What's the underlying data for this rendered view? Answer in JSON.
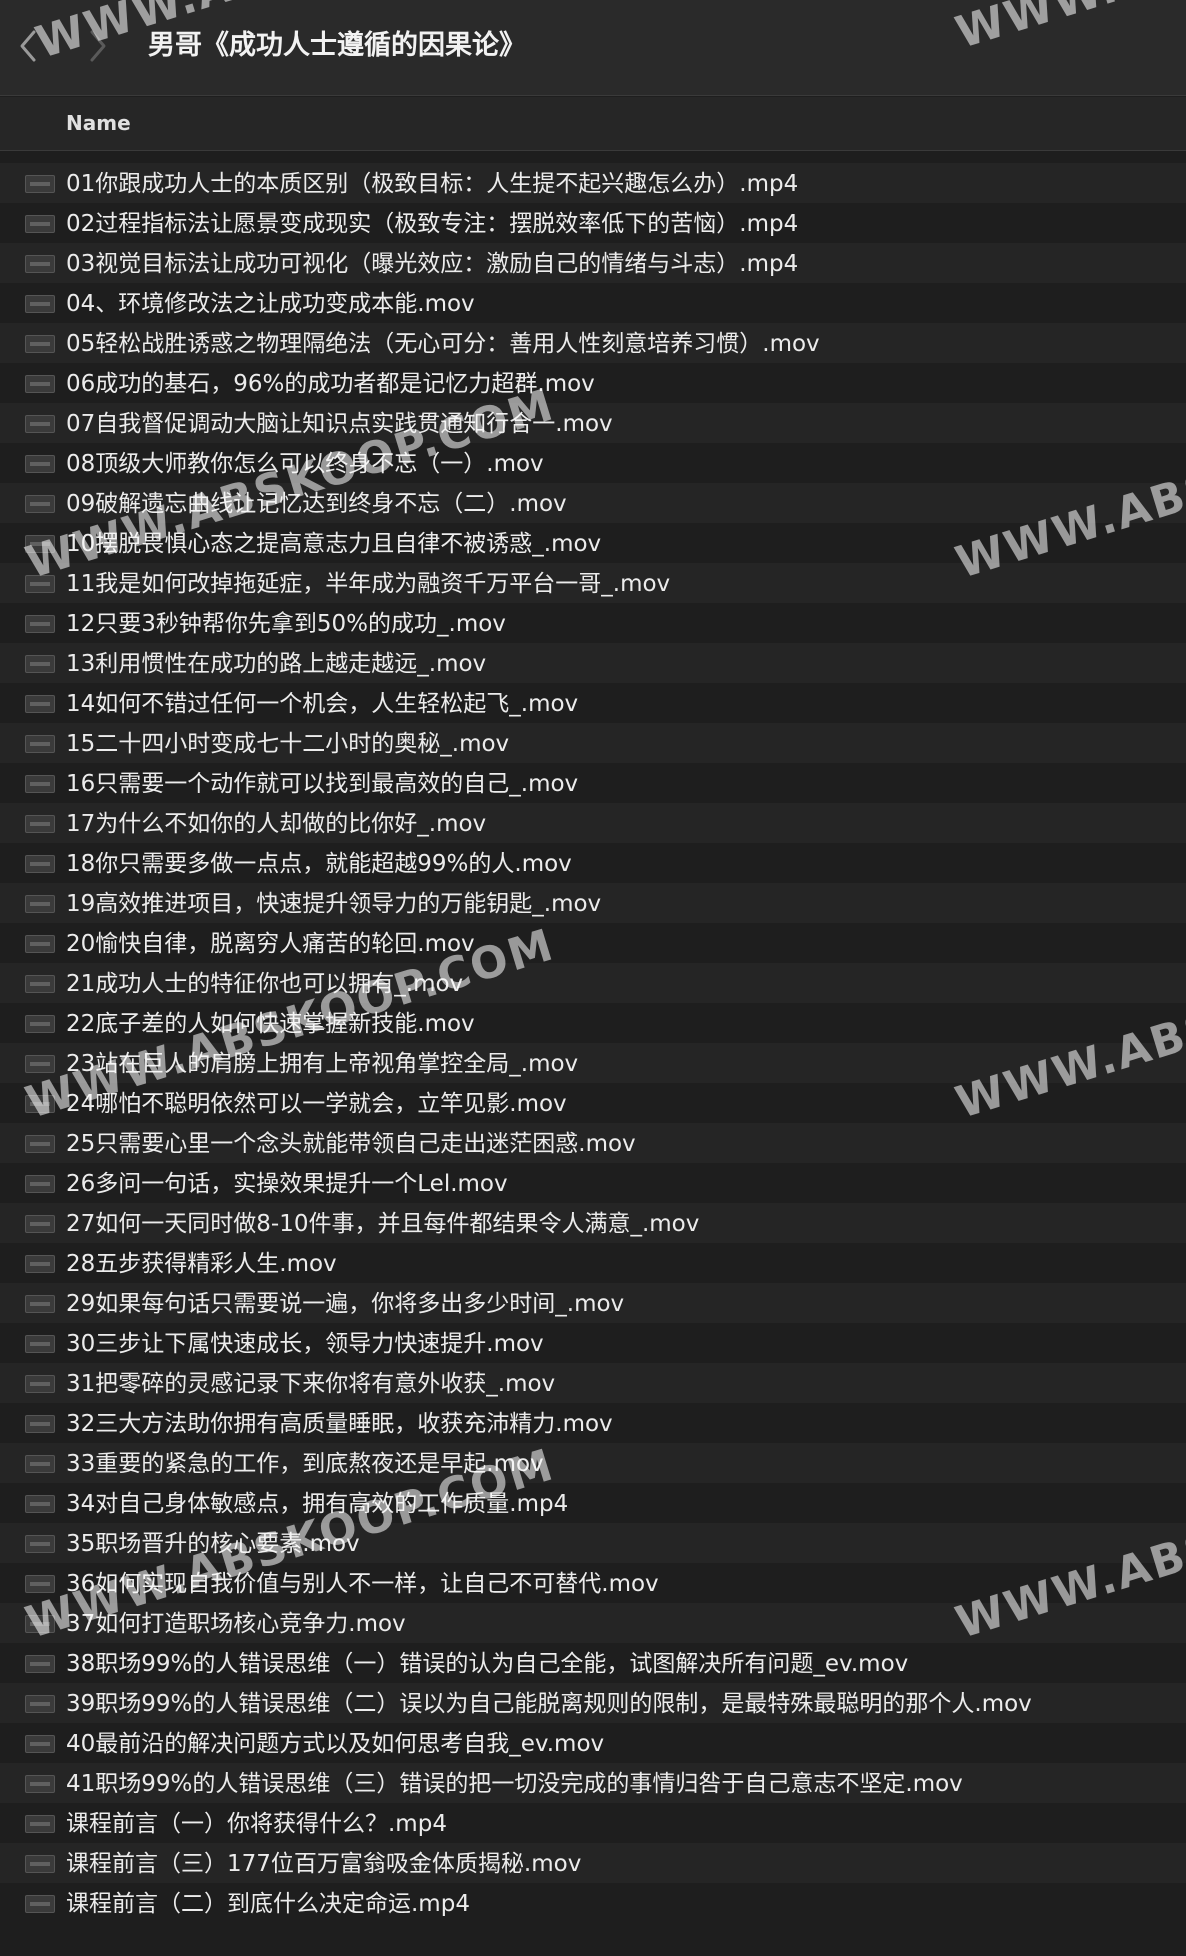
{
  "window": {
    "title": "男哥《成功人士遵循的因果论》",
    "back_icon": "chevron-left-icon",
    "forward_icon": "chevron-right-icon"
  },
  "header": {
    "name_column": "Name"
  },
  "files": [
    "01你跟成功人士的本质区别（极致目标：人生提不起兴趣怎么办）.mp4",
    "02过程指标法让愿景变成现实（极致专注：摆脱效率低下的苦恼）.mp4",
    "03视觉目标法让成功可视化（曝光效应：激励自己的情绪与斗志）.mp4",
    "04、环境修改法之让成功变成本能.mov",
    "05轻松战胜诱惑之物理隔绝法（无心可分：善用人性刻意培养习惯）.mov",
    "06成功的基石，96%的成功者都是记忆力超群.mov",
    "07自我督促调动大脑让知识点实践贯通知行合一.mov",
    "08顶级大师教你怎么可以终身不忘（一）.mov",
    "09破解遗忘曲线让记忆达到终身不忘（二）.mov",
    "10摆脱畏惧心态之提高意志力且自律不被诱惑_.mov",
    "11我是如何改掉拖延症，半年成为融资千万平台一哥_.mov",
    "12只要3秒钟帮你先拿到50%的成功_.mov",
    "13利用惯性在成功的路上越走越远_.mov",
    "14如何不错过任何一个机会，人生轻松起飞_.mov",
    "15二十四小时变成七十二小时的奥秘_.mov",
    "16只需要一个动作就可以找到最高效的自己_.mov",
    "17为什么不如你的人却做的比你好_.mov",
    "18你只需要多做一点点，就能超越99%的人.mov",
    "19高效推进项目，快速提升领导力的万能钥匙_.mov",
    "20愉快自律，脱离穷人痛苦的轮回.mov",
    "21成功人士的特征你也可以拥有_.mov",
    "22底子差的人如何快速掌握新技能.mov",
    "23站在巨人的肩膀上拥有上帝视角掌控全局_.mov",
    "24哪怕不聪明依然可以一学就会，立竿见影.mov",
    "25只需要心里一个念头就能带领自己走出迷茫困惑.mov",
    "26多问一句话，实操效果提升一个Lel.mov",
    "27如何一天同时做8-10件事，并且每件都结果令人满意_.mov",
    "28五步获得精彩人生.mov",
    "29如果每句话只需要说一遍，你将多出多少时间_.mov",
    "30三步让下属快速成长，领导力快速提升.mov",
    "31把零碎的灵感记录下来你将有意外收获_.mov",
    "32三大方法助你拥有高质量睡眠，收获充沛精力.mov",
    "33重要的紧急的工作，到底熬夜还是早起.mov",
    "34对自己身体敏感点，拥有高效的工作质量.mp4",
    "35职场晋升的核心要素.mov",
    "36如何实现自我价值与别人不一样，让自己不可替代.mov",
    "37如何打造职场核心竞争力.mov",
    "38职场99%的人错误思维（一）错误的认为自己全能，试图解决所有问题_ev.mov",
    "39职场99%的人错误思维（二）误以为自己能脱离规则的限制，是最特殊最聪明的那个人.mov",
    "40最前沿的解决问题方式以及如何思考自我_ev.mov",
    "41职场99%的人错误思维（三）错误的把一切没完成的事情归咎于自己意志不坚定.mov",
    "课程前言（一）你将获得什么？.mp4",
    "课程前言（三）177位百万富翁吸金体质揭秘.mov",
    "课程前言（二）到底什么决定命运.mp4"
  ],
  "watermark": "WWW.ABSKOOP.COM",
  "colors": {
    "background": "#1e1e1e",
    "titlebar": "#2a2a2a",
    "text": "#ececec"
  }
}
